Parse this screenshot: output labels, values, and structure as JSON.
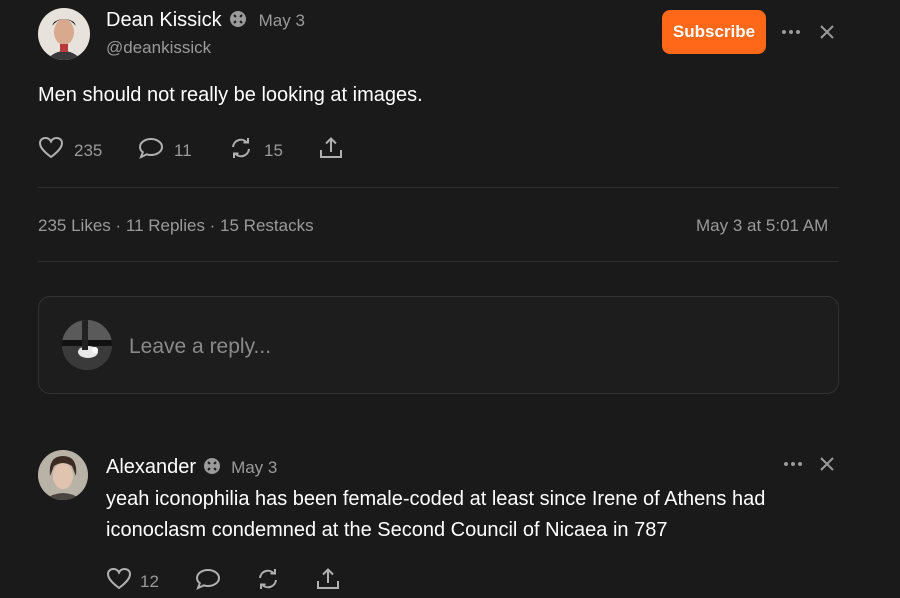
{
  "post": {
    "author": "Dean Kissick",
    "date": "May 3",
    "handle": "@deankissick",
    "subscribe_label": "Subscribe",
    "text": "Men should not really be looking at images.",
    "likes": "235",
    "replies": "11",
    "restacks": "15",
    "stats_line": "235 Likes · 11 Replies · 15 Restacks",
    "timestamp": "May 3 at 5:01 AM"
  },
  "reply_box": {
    "placeholder": "Leave a reply..."
  },
  "comment": {
    "author": "Alexander",
    "date": "May 3",
    "text": "yeah iconophilia has been female-coded at least since Irene of Athens had iconoclasm condemned at the Second Council of Nicaea in 787",
    "likes": "12"
  },
  "colors": {
    "background": "#1a1a1a",
    "accent": "#ff6719",
    "muted_text": "#9a9a9a"
  },
  "icons": [
    "verified-badge-icon",
    "more-icon",
    "close-icon",
    "heart-icon",
    "comment-icon",
    "restack-icon",
    "share-icon"
  ]
}
